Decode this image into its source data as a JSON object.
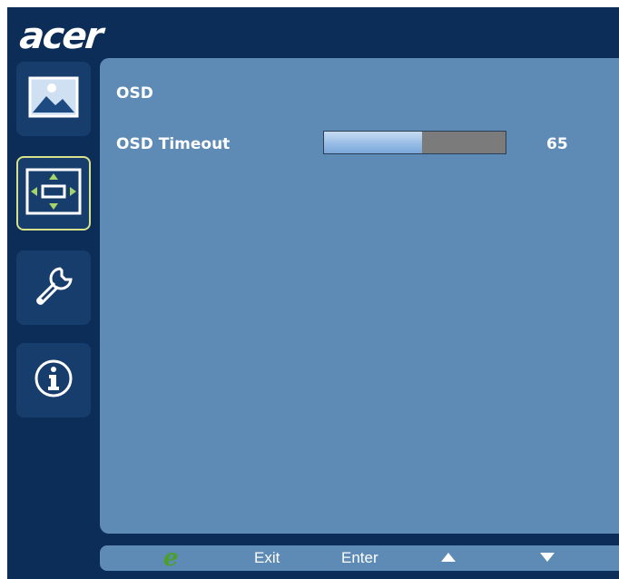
{
  "brand": {
    "logo_text": "acer"
  },
  "sidebar": {
    "items": [
      {
        "name": "picture",
        "icon": "picture-icon"
      },
      {
        "name": "osd",
        "icon": "osd-position-icon",
        "active": true
      },
      {
        "name": "settings",
        "icon": "wrench-icon"
      },
      {
        "name": "information",
        "icon": "info-icon"
      }
    ]
  },
  "main": {
    "section_title": "OSD",
    "items": [
      {
        "label": "OSD Timeout",
        "value": "65",
        "level_percent": 54
      }
    ]
  },
  "footer": {
    "e_key": "e",
    "exit_label": "Exit",
    "enter_label": "Enter",
    "up_icon": "up-arrow-icon",
    "down_icon": "down-arrow-icon"
  },
  "colors": {
    "frame": "#0b2d57",
    "panel": "#5e8bb5",
    "active_border": "#d7e28a",
    "slider_fill": "#97bde6",
    "slider_track": "#7b7b7b",
    "e_key": "#4ba028"
  }
}
